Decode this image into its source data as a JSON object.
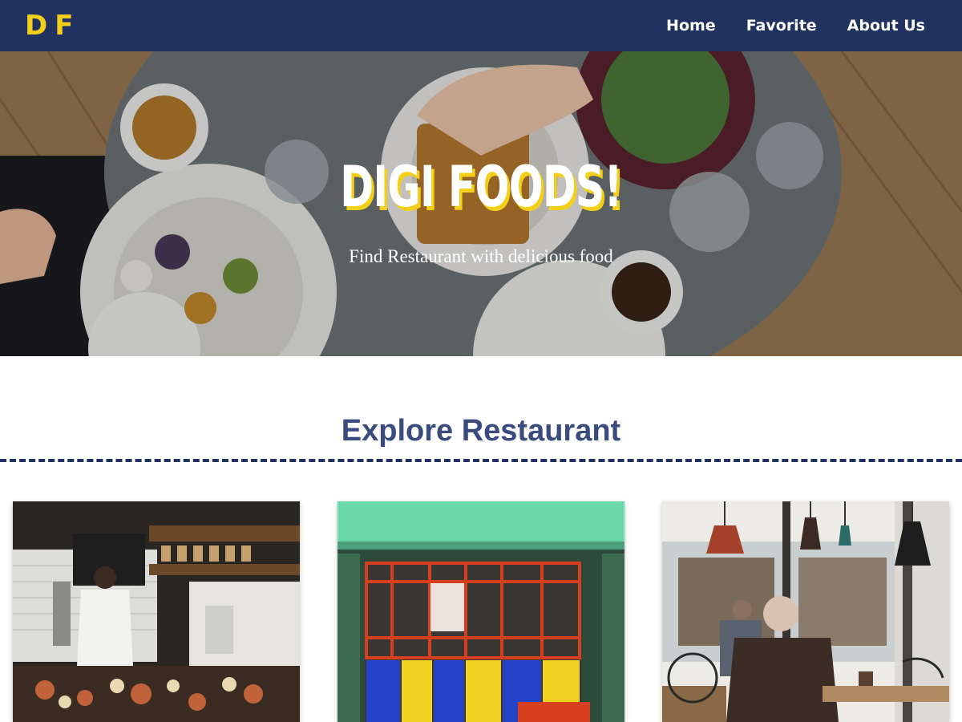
{
  "navbar": {
    "logo": "DF",
    "links": [
      {
        "label": "Home"
      },
      {
        "label": "Favorite"
      },
      {
        "label": "About Us"
      }
    ]
  },
  "hero": {
    "title": "DIGI FOODS!",
    "subtitle": "Find Restaurant with delicious food"
  },
  "section": {
    "title": "Explore Restaurant"
  },
  "colors": {
    "navbar_bg": "#223260",
    "accent_yellow": "#f3cf19",
    "section_title": "#3c4b7d"
  }
}
